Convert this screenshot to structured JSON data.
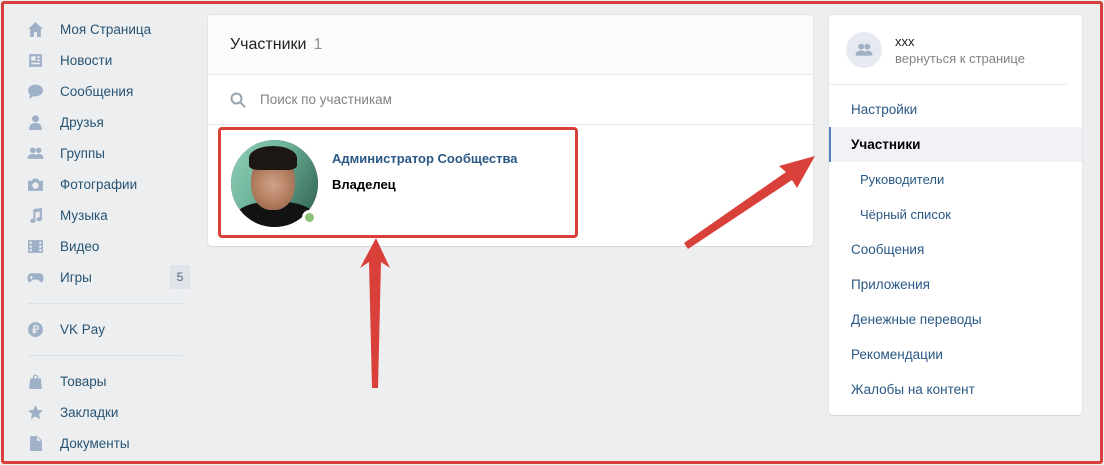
{
  "left_nav": {
    "items": [
      {
        "label": "Моя Страница",
        "icon": "home-icon"
      },
      {
        "label": "Новости",
        "icon": "news-icon"
      },
      {
        "label": "Сообщения",
        "icon": "messages-icon"
      },
      {
        "label": "Друзья",
        "icon": "friends-icon"
      },
      {
        "label": "Группы",
        "icon": "groups-icon"
      },
      {
        "label": "Фотографии",
        "icon": "camera-icon"
      },
      {
        "label": "Музыка",
        "icon": "music-icon"
      },
      {
        "label": "Видео",
        "icon": "video-icon"
      },
      {
        "label": "Игры",
        "icon": "gamepad-icon",
        "badge": "5"
      }
    ],
    "pay": {
      "label": "VK Pay",
      "icon": "vk-pay-icon"
    },
    "extra": [
      {
        "label": "Товары",
        "icon": "shopping-bag-icon"
      },
      {
        "label": "Закладки",
        "icon": "star-icon"
      },
      {
        "label": "Документы",
        "icon": "document-icon"
      }
    ]
  },
  "members": {
    "title": "Участники",
    "count": "1",
    "search_placeholder": "Поиск по участникам",
    "member": {
      "role": "Администратор Сообщества",
      "status": "Владелец",
      "online": true
    }
  },
  "menu": {
    "group_name": "xxx",
    "back_link": "вернуться к странице",
    "items": [
      {
        "label": "Настройки"
      },
      {
        "label": "Участники",
        "active": true
      },
      {
        "label": "Руководители",
        "sub": true
      },
      {
        "label": "Чёрный список",
        "sub": true
      },
      {
        "label": "Сообщения"
      },
      {
        "label": "Приложения"
      },
      {
        "label": "Денежные переводы"
      },
      {
        "label": "Рекомендации"
      },
      {
        "label": "Жалобы на контент"
      }
    ]
  },
  "colors": {
    "accent": "#2a5885",
    "highlight": "#d9403a",
    "online": "#8ac176",
    "icon": "#9eb1c6"
  }
}
